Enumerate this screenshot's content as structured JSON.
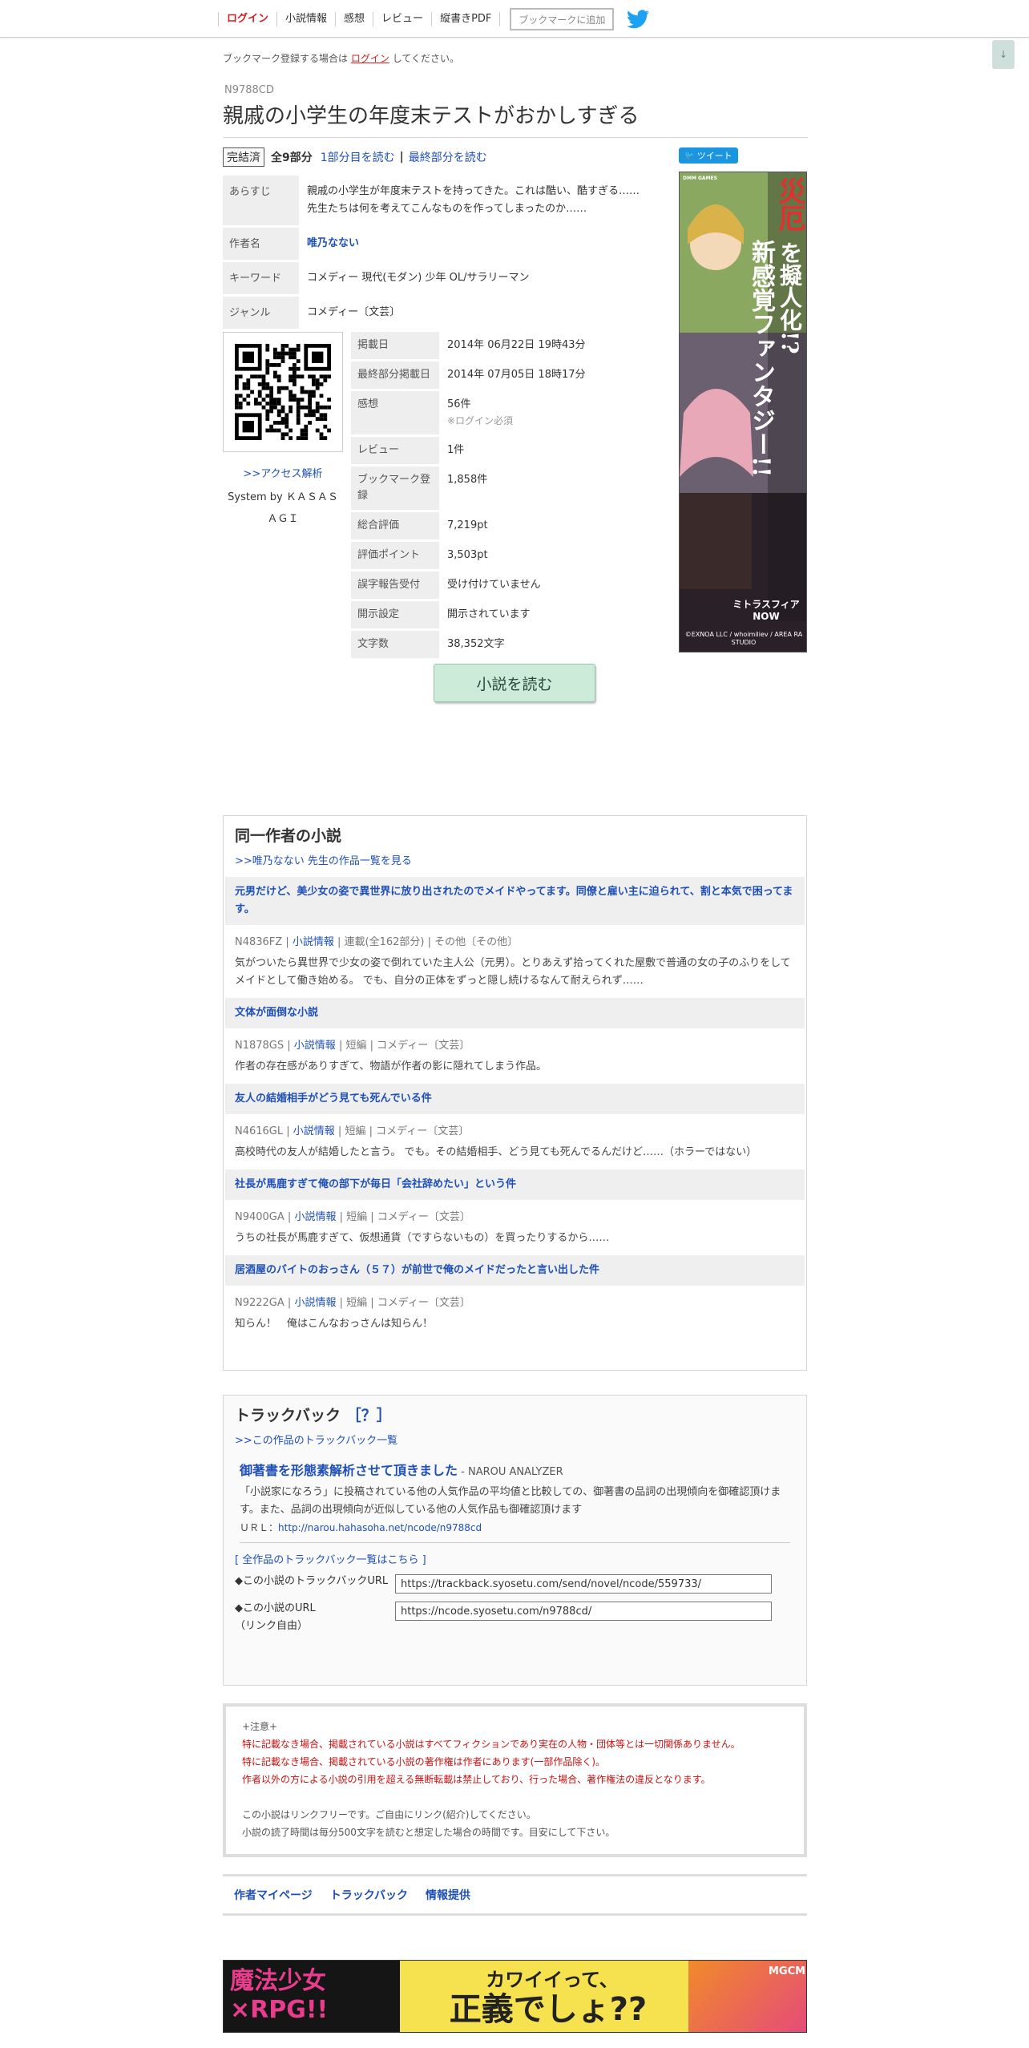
{
  "nav": {
    "items": [
      "ログイン",
      "小説情報",
      "感想",
      "レビュー",
      "縦書きPDF"
    ],
    "bookmark_button": "ブックマークに追加"
  },
  "login_note": {
    "prefix": "ブックマーク登録する場合は",
    "link": "ログイン",
    "suffix": "してください。"
  },
  "scroll_button": "↓",
  "novel": {
    "ncode": "N9788CD",
    "title": "親戚の小学生の年度末テストがおかしすぎる",
    "status": "完結済",
    "episodes": "全9部分",
    "first_link": "1部分目を読む",
    "last_link": "最終部分を読む"
  },
  "info": {
    "synopsis_label": "あらすじ",
    "synopsis": "親戚の小学生が年度末テストを持ってきた。これは酷い、酷すぎる……先生たちは何を考えてこんなものを作ってしまったのか……",
    "author_label": "作者名",
    "author": "唯乃なない",
    "keyword_label": "キーワード",
    "keyword": "コメディー 現代(モダン) 少年 OL/サラリーマン",
    "genre_label": "ジャンル",
    "genre": "コメディー〔文芸〕"
  },
  "stats": {
    "published_label": "掲載日",
    "published": "2014年 06月22日 19時43分",
    "last_label": "最終部分掲載日",
    "last": "2014年 07月05日 18時17分",
    "impressions_label": "感想",
    "impressions": "56件",
    "impressions_note": "※ログイン必須",
    "reviews_label": "レビュー",
    "reviews": "1件",
    "bookmarks_label": "ブックマーク登録",
    "bookmarks": "1,858件",
    "total_label": "総合評価",
    "total": "7,219pt",
    "points_label": "評価ポイント",
    "points": "3,503pt",
    "typo_label": "誤字報告受付",
    "typo": "受け付けていません",
    "disclosure_label": "開示設定",
    "disclosure": "開示されています",
    "chars_label": "文字数",
    "chars": "38,352文字"
  },
  "access_link": ">>アクセス解析",
  "system_by": "System by ＫＡＳＡＳＡＧＩ",
  "tweet_button": "ツイート",
  "side_ad": {
    "text1": "災厄",
    "text2": "を擬人化!?",
    "text3": "新感覚ファンタジー!!",
    "brand": "DMM GAMES",
    "logo": "ミトラスフィアNOW",
    "credit": "©EXNOA LLC / whoimiliev / AREA RA STUDIO"
  },
  "read_button": "小説を読む",
  "same_author": {
    "title": "同一作者の小説",
    "list_link": ">>唯乃なない 先生の作品一覧を見る",
    "novels": [
      {
        "title": "元男だけど、美少女の姿で異世界に放り出されたのでメイドやってます。同僚と雇い主に迫られて、割と本気で困ってます。",
        "code": "N4836FZ",
        "info": "小説情報",
        "type": "連載(全162部分)",
        "genre": "その他〔その他〕",
        "desc": "気がついたら異世界で少女の姿で倒れていた主人公（元男）。とりあえず拾ってくれた屋敷で普通の女の子のふりをしてメイドとして働き始める。 でも、自分の正体をずっと隠し続けるなんて耐えられず……"
      },
      {
        "title": "文体が面倒な小説",
        "code": "N1878GS",
        "info": "小説情報",
        "type": "短編",
        "genre": "コメディー〔文芸〕",
        "desc": "作者の存在感がありすぎて、物語が作者の影に隠れてしまう作品。"
      },
      {
        "title": "友人の結婚相手がどう見ても死んでいる件",
        "code": "N4616GL",
        "info": "小説情報",
        "type": "短編",
        "genre": "コメディー〔文芸〕",
        "desc": "高校時代の友人が結婚したと言う。 でも。その結婚相手、どう見ても死んでるんだけど……（ホラーではない）"
      },
      {
        "title": "社長が馬鹿すぎて俺の部下が毎日「会社辞めたい」という件",
        "code": "N9400GA",
        "info": "小説情報",
        "type": "短編",
        "genre": "コメディー〔文芸〕",
        "desc": "うちの社長が馬鹿すぎて、仮想通貨（ですらないもの）を買ったりするから……"
      },
      {
        "title": "居酒屋のバイトのおっさん（５７）が前世で俺のメイドだったと言い出した件",
        "code": "N9222GA",
        "info": "小説情報",
        "type": "短編",
        "genre": "コメディー〔文芸〕",
        "desc": "知らん！　俺はこんなおっさんは知らん！"
      }
    ]
  },
  "trackback": {
    "title": "トラックバック",
    "help": "［？］",
    "list_link": ">>この作品のトラックバック一覧",
    "item_title": "御著書を形態素解析させて頂きました",
    "item_site": "- NAROU ANALYZER",
    "item_desc": "「小説家になろう」に投稿されている他の人気作品の平均値と比較しての、御著書の品詞の出現傾向を御確認頂けます。また、品詞の出現傾向が近似している他の人気作品も御確認頂けます",
    "item_url_label": "ＵＲＬ：",
    "item_url": "http://narou.hahasoha.net/ncode/n9788cd",
    "all_link": "[ 全作品のトラックバック一覧はこちら ]",
    "tb_url_label": "◆この小説のトラックバックURL",
    "tb_url": "https://trackback.syosetu.com/send/novel/ncode/559733/",
    "novel_url_label": "◆この小説のURL",
    "novel_url_note": "（リンク自由）",
    "novel_url": "https://ncode.syosetu.com/n9788cd/"
  },
  "notice": {
    "head": "+注意+",
    "line1": "特に記載なき場合、掲載されている小説はすべてフィクションであり実在の人物・団体等とは一切関係ありません。",
    "line2": "特に記載なき場合、掲載されている小説の著作権は作者にあります(一部作品除く)。",
    "line3": "作者以外の方による小説の引用を超える無断転載は禁止しており、行った場合、著作権法の違反となります。",
    "line4": "この小説はリンクフリーです。ご自由にリンク(紹介)してください。",
    "line5": "小説の読了時間は毎分500文字を読むと想定した場合の時間です。目安にして下さい。"
  },
  "footer_nav": [
    "作者マイページ",
    "トラックバック",
    "情報提供"
  ],
  "bottom_ad": {
    "left": "魔法少女×RPG!!",
    "headline": "カワイイって、",
    "main": "正義でしょ??",
    "brand": "MGCM"
  }
}
